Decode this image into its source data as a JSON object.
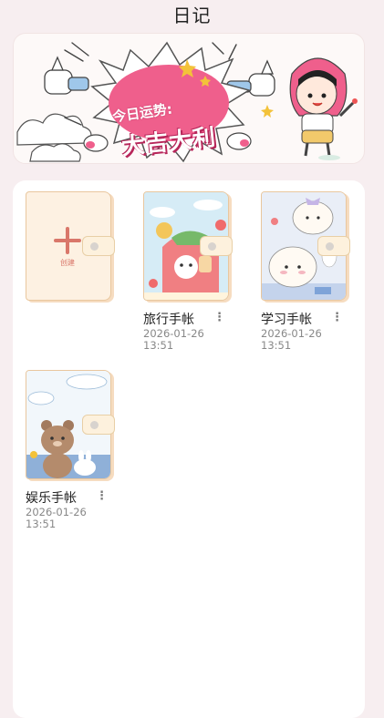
{
  "header": {
    "title": "日记"
  },
  "banner": {
    "line1": "今日运势:",
    "line2": "大吉大利"
  },
  "create": {
    "label": "创建",
    "icon": "plus-icon"
  },
  "notebooks": [
    {
      "name": "旅行手帐",
      "date": "2026-01-26",
      "time": "13:51",
      "theme": "strawberry"
    },
    {
      "name": "学习手帐",
      "date": "2026-01-26",
      "time": "13:51",
      "theme": "puppies"
    },
    {
      "name": "娱乐手帐",
      "date": "2026-01-26",
      "time": "13:51",
      "theme": "bear"
    }
  ],
  "more_icon": "more-vertical-icon",
  "colors": {
    "background": "#f7eef0",
    "burst_pink": "#ef5f8c",
    "cover_border": "#e9c79e",
    "accent_red": "#d9776a"
  }
}
